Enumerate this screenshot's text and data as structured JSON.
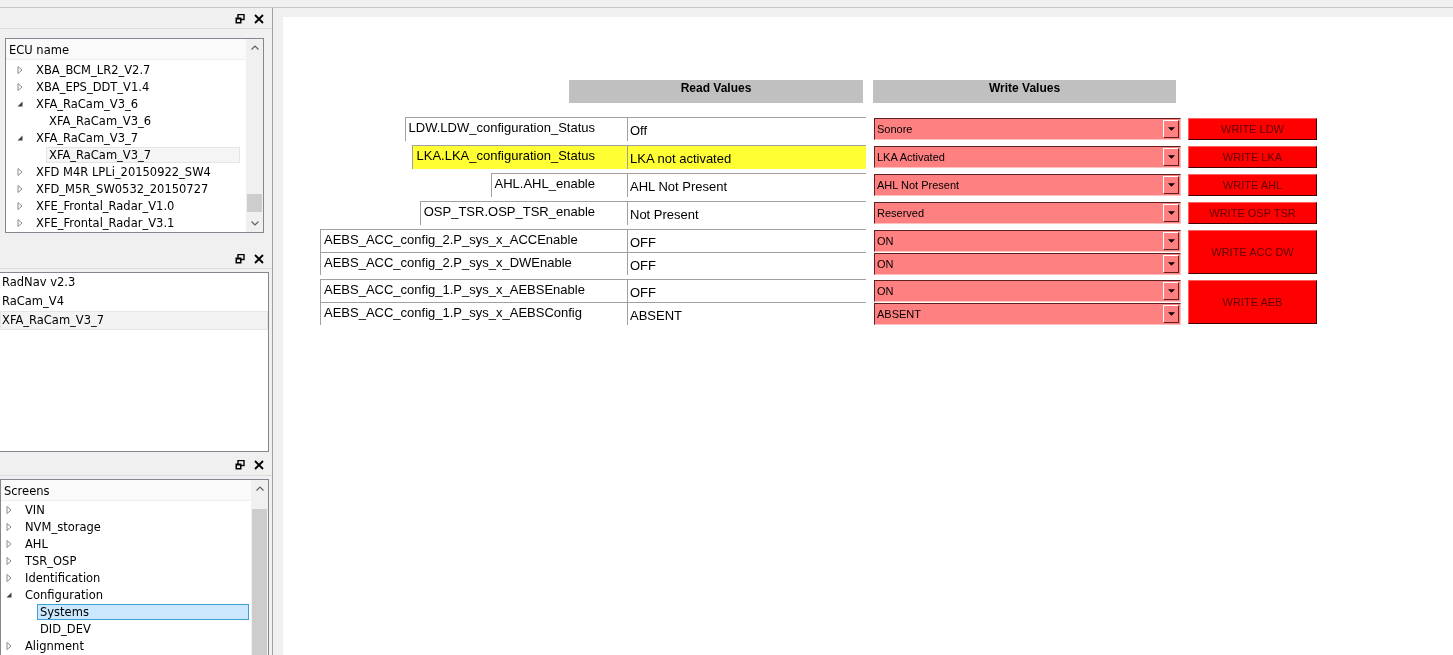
{
  "ecu_panel": {
    "header": "ECU name",
    "items": [
      {
        "label": "XBA_BCM_LR2_V2.7",
        "expanded": false,
        "selected": false
      },
      {
        "label": "XBA_EPS_DDT_V1.4",
        "expanded": false,
        "selected": false
      },
      {
        "label": "XFA_RaCam_V3_6",
        "expanded": true,
        "selected": false,
        "children": [
          {
            "label": "XFA_RaCam_V3_6",
            "selected": false
          }
        ]
      },
      {
        "label": "XFA_RaCam_V3_7",
        "expanded": true,
        "selected": false,
        "children": [
          {
            "label": "XFA_RaCam_V3_7",
            "selected": true
          }
        ]
      },
      {
        "label": "XFD M4R LPLi_20150922_SW4",
        "expanded": false,
        "selected": false
      },
      {
        "label": "XFD_M5R_SW0532_20150727",
        "expanded": false,
        "selected": false
      },
      {
        "label": "XFE_Frontal_Radar_V1.0",
        "expanded": false,
        "selected": false
      },
      {
        "label": "XFE_Frontal_Radar_V3.1",
        "expanded": false,
        "selected": false
      }
    ]
  },
  "ecu_list": {
    "items": [
      {
        "label": "RadNav v2.3",
        "selected": false
      },
      {
        "label": "RaCam_V4",
        "selected": false
      },
      {
        "label": "XFA_RaCam_V3_7",
        "selected": true
      }
    ]
  },
  "screens_panel": {
    "header": "Screens",
    "items": [
      {
        "label": "VIN",
        "expanded": false,
        "selected": false
      },
      {
        "label": "NVM_storage",
        "expanded": false,
        "selected": false
      },
      {
        "label": "AHL",
        "expanded": false,
        "selected": false
      },
      {
        "label": "TSR_OSP",
        "expanded": false,
        "selected": false
      },
      {
        "label": "Identification",
        "expanded": false,
        "selected": false
      },
      {
        "label": "Configuration",
        "expanded": true,
        "selected": false,
        "children": [
          {
            "label": "Systems",
            "selected": true
          },
          {
            "label": "DID_DEV",
            "selected": false
          }
        ]
      },
      {
        "label": "Alignment",
        "expanded": false,
        "selected": false
      }
    ]
  },
  "form": {
    "read_header": "Read Values",
    "write_header": "Write Values",
    "groups": [
      {
        "button": "WRITE LDW",
        "rows": [
          {
            "label": "LDW.LDW_configuration_Status",
            "read": "Off",
            "write": "Sonore",
            "highlighted": false
          }
        ]
      },
      {
        "button": "WRITE LKA",
        "rows": [
          {
            "label": "LKA.LKA_configuration_Status",
            "read": "LKA not activated",
            "write": "LKA Activated",
            "highlighted": true
          }
        ]
      },
      {
        "button": "WRITE AHL",
        "rows": [
          {
            "label": "AHL.AHL_enable",
            "read": "AHL Not Present",
            "write": "AHL Not Present",
            "highlighted": false
          }
        ]
      },
      {
        "button": "WRITE OSP TSR",
        "rows": [
          {
            "label": "OSP_TSR.OSP_TSR_enable",
            "read": "Not Present",
            "write": "Reserved",
            "highlighted": false
          }
        ]
      },
      {
        "button": "WRITE ACC DW",
        "rows": [
          {
            "label": "AEBS_ACC_config_2.P_sys_x_ACCEnable",
            "read": "OFF",
            "write": "ON",
            "highlighted": false
          },
          {
            "label": "AEBS_ACC_config_2.P_sys_x_DWEnable",
            "read": "OFF",
            "write": "ON",
            "highlighted": false
          }
        ]
      },
      {
        "button": "WRITE AEB",
        "rows": [
          {
            "label": "AEBS_ACC_config_1.P_sys_x_AEBSEnable",
            "read": "OFF",
            "write": "ON",
            "highlighted": false
          },
          {
            "label": "AEBS_ACC_config_1.P_sys_x_AEBSConfig",
            "read": "ABSENT",
            "write": "ABSENT",
            "highlighted": false
          }
        ]
      }
    ]
  }
}
